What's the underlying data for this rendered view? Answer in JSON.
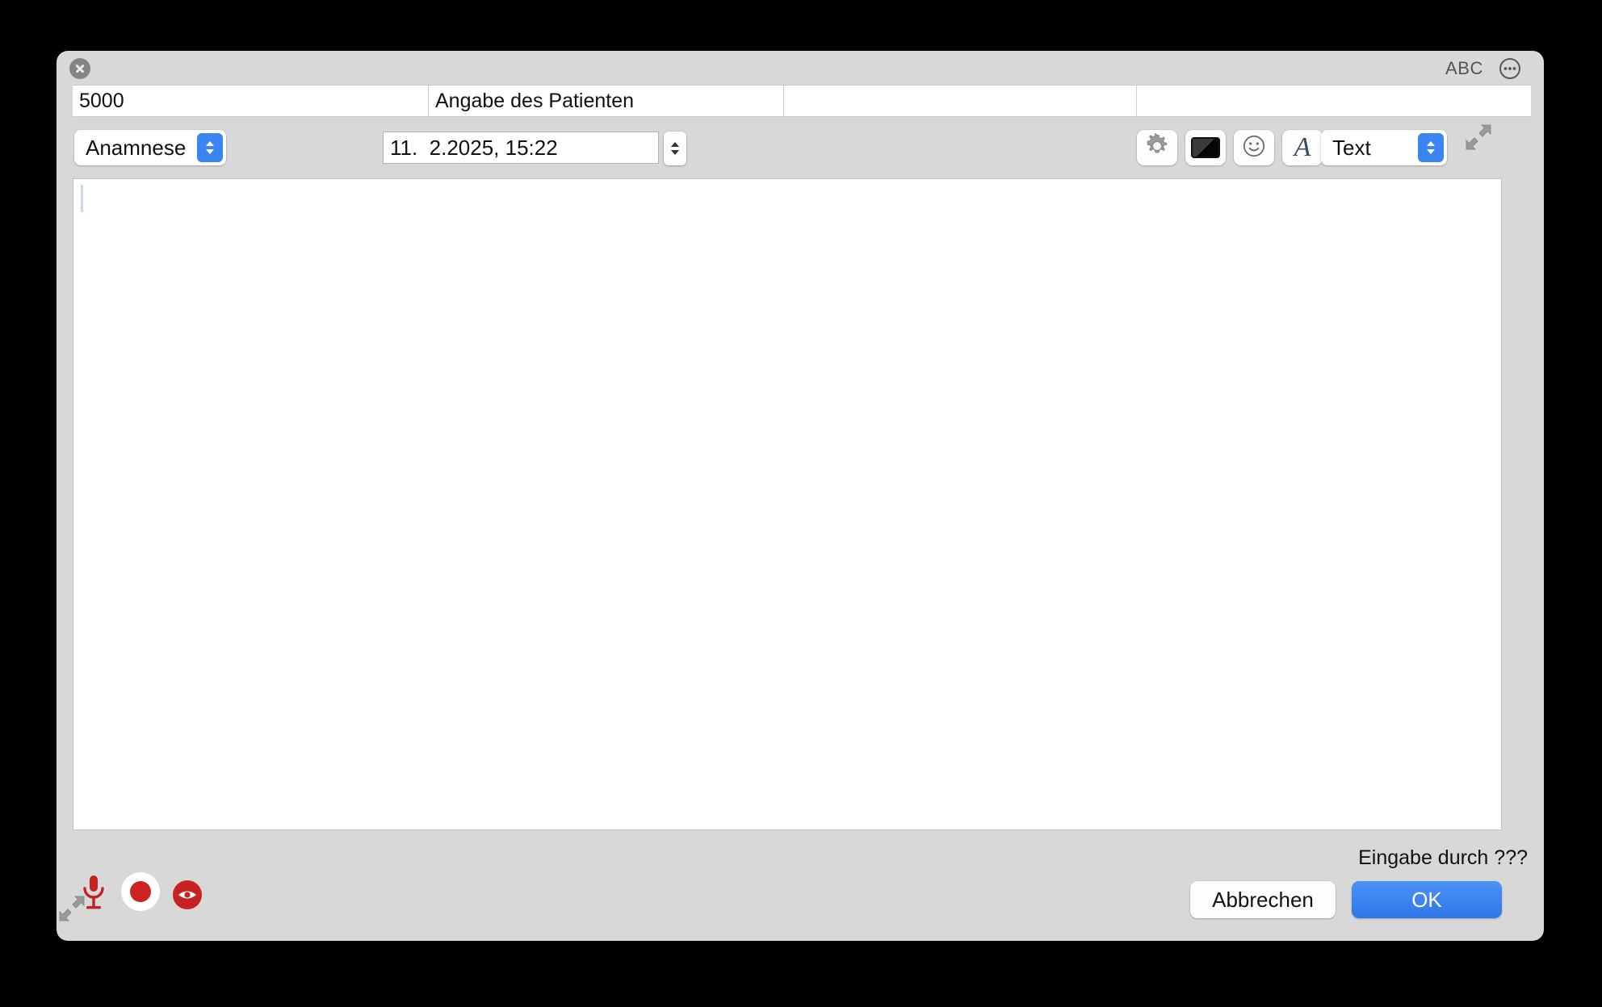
{
  "window": {
    "close_icon": "close-icon",
    "spellcheck_label": "ABC",
    "more_icon": "more-options-icon",
    "expand_icon": "expand-arrows-icon",
    "resize_icon": "resize-grip-icon"
  },
  "field_row": {
    "cells": [
      {
        "name": "code-field",
        "value": "5000"
      },
      {
        "name": "description-field",
        "value": "Angabe des Patienten"
      },
      {
        "name": "extra-field-1",
        "value": ""
      },
      {
        "name": "extra-field-2",
        "value": ""
      }
    ]
  },
  "toolbar": {
    "category": {
      "label": "Anamnese",
      "options": [
        "Anamnese"
      ]
    },
    "date": {
      "value": "11.  2.2025, 15:22",
      "stepper_icon": "stepper-up-down-icon"
    },
    "buttons": [
      {
        "name": "settings-button",
        "icon": "gear-icon"
      },
      {
        "name": "color-button",
        "icon": "color-swatch-icon"
      },
      {
        "name": "emoji-button",
        "icon": "smiley-icon"
      },
      {
        "name": "font-button",
        "icon": "font-a-icon"
      }
    ],
    "style": {
      "label": "Text",
      "options": [
        "Text"
      ]
    }
  },
  "editor": {
    "content": "",
    "caret": true
  },
  "footer": {
    "status": "Eingabe durch ???",
    "media": [
      {
        "name": "microphone-button",
        "icon": "microphone-icon"
      },
      {
        "name": "record-button",
        "icon": "record-icon"
      },
      {
        "name": "preview-button",
        "icon": "eye-icon"
      }
    ],
    "cancel_label": "Abbrechen",
    "ok_label": "OK"
  },
  "colors": {
    "accent": "#3a85f2",
    "ok_button": "#2f76e8",
    "record_red": "#cc2222",
    "window_bg": "#d8d8d8",
    "desktop_bg": "#000000"
  }
}
